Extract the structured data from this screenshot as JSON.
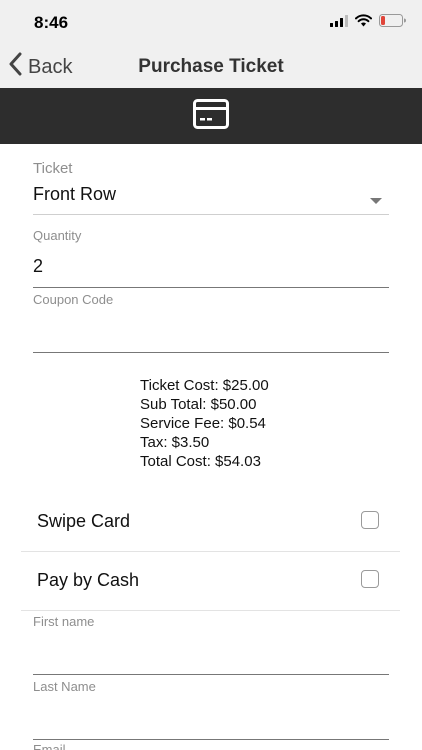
{
  "status_bar": {
    "time": "8:46",
    "icons": [
      "cellular-signal-icon",
      "wifi-icon",
      "battery-icon"
    ],
    "battery_color": "#e0453a"
  },
  "nav": {
    "back_label": "Back",
    "title": "Purchase Ticket"
  },
  "banner": {
    "icon": "credit-card-icon",
    "background": "#2d2d2d"
  },
  "form": {
    "ticket": {
      "label": "Ticket",
      "value": "Front Row"
    },
    "quantity": {
      "label": "Quantity",
      "value": "2"
    },
    "coupon": {
      "label": "Coupon Code",
      "value": ""
    }
  },
  "summary": {
    "ticket_cost": "Ticket Cost: $25.00",
    "sub_total": "Sub Total: $50.00",
    "service_fee": "Service Fee: $0.54",
    "tax": "Tax: $3.50",
    "total_cost": "Total Cost: $54.03"
  },
  "payment_options": {
    "swipe_card": {
      "label": "Swipe Card",
      "checked": false
    },
    "pay_by_cash": {
      "label": "Pay by Cash",
      "checked": false
    }
  },
  "customer": {
    "first_name": {
      "label": "First name",
      "value": ""
    },
    "last_name": {
      "label": "Last Name",
      "value": ""
    },
    "email": {
      "label": "Email",
      "value": ""
    }
  }
}
